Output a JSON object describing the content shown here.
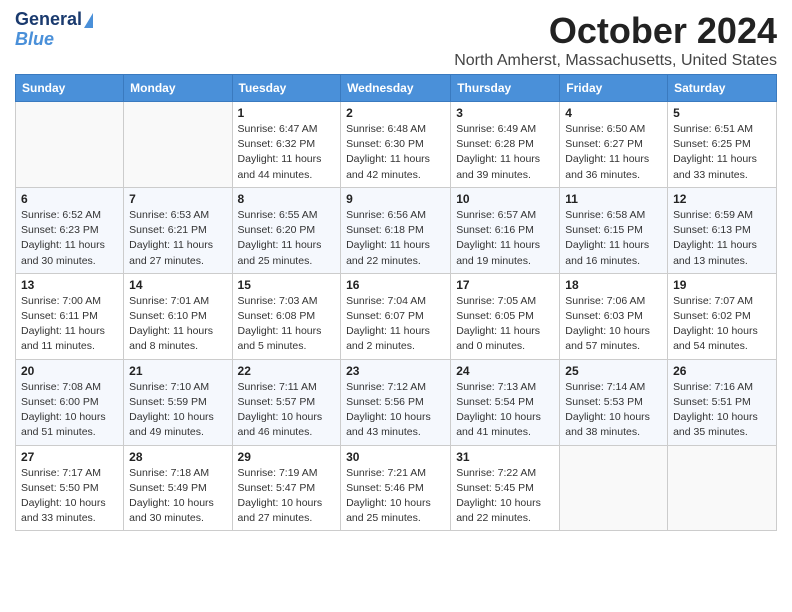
{
  "header": {
    "logo_line1": "General",
    "logo_line2": "Blue",
    "month_title": "October 2024",
    "location": "North Amherst, Massachusetts, United States"
  },
  "weekdays": [
    "Sunday",
    "Monday",
    "Tuesday",
    "Wednesday",
    "Thursday",
    "Friday",
    "Saturday"
  ],
  "weeks": [
    [
      {
        "day": "",
        "detail": ""
      },
      {
        "day": "",
        "detail": ""
      },
      {
        "day": "1",
        "detail": "Sunrise: 6:47 AM\nSunset: 6:32 PM\nDaylight: 11 hours and 44 minutes."
      },
      {
        "day": "2",
        "detail": "Sunrise: 6:48 AM\nSunset: 6:30 PM\nDaylight: 11 hours and 42 minutes."
      },
      {
        "day": "3",
        "detail": "Sunrise: 6:49 AM\nSunset: 6:28 PM\nDaylight: 11 hours and 39 minutes."
      },
      {
        "day": "4",
        "detail": "Sunrise: 6:50 AM\nSunset: 6:27 PM\nDaylight: 11 hours and 36 minutes."
      },
      {
        "day": "5",
        "detail": "Sunrise: 6:51 AM\nSunset: 6:25 PM\nDaylight: 11 hours and 33 minutes."
      }
    ],
    [
      {
        "day": "6",
        "detail": "Sunrise: 6:52 AM\nSunset: 6:23 PM\nDaylight: 11 hours and 30 minutes."
      },
      {
        "day": "7",
        "detail": "Sunrise: 6:53 AM\nSunset: 6:21 PM\nDaylight: 11 hours and 27 minutes."
      },
      {
        "day": "8",
        "detail": "Sunrise: 6:55 AM\nSunset: 6:20 PM\nDaylight: 11 hours and 25 minutes."
      },
      {
        "day": "9",
        "detail": "Sunrise: 6:56 AM\nSunset: 6:18 PM\nDaylight: 11 hours and 22 minutes."
      },
      {
        "day": "10",
        "detail": "Sunrise: 6:57 AM\nSunset: 6:16 PM\nDaylight: 11 hours and 19 minutes."
      },
      {
        "day": "11",
        "detail": "Sunrise: 6:58 AM\nSunset: 6:15 PM\nDaylight: 11 hours and 16 minutes."
      },
      {
        "day": "12",
        "detail": "Sunrise: 6:59 AM\nSunset: 6:13 PM\nDaylight: 11 hours and 13 minutes."
      }
    ],
    [
      {
        "day": "13",
        "detail": "Sunrise: 7:00 AM\nSunset: 6:11 PM\nDaylight: 11 hours and 11 minutes."
      },
      {
        "day": "14",
        "detail": "Sunrise: 7:01 AM\nSunset: 6:10 PM\nDaylight: 11 hours and 8 minutes."
      },
      {
        "day": "15",
        "detail": "Sunrise: 7:03 AM\nSunset: 6:08 PM\nDaylight: 11 hours and 5 minutes."
      },
      {
        "day": "16",
        "detail": "Sunrise: 7:04 AM\nSunset: 6:07 PM\nDaylight: 11 hours and 2 minutes."
      },
      {
        "day": "17",
        "detail": "Sunrise: 7:05 AM\nSunset: 6:05 PM\nDaylight: 11 hours and 0 minutes."
      },
      {
        "day": "18",
        "detail": "Sunrise: 7:06 AM\nSunset: 6:03 PM\nDaylight: 10 hours and 57 minutes."
      },
      {
        "day": "19",
        "detail": "Sunrise: 7:07 AM\nSunset: 6:02 PM\nDaylight: 10 hours and 54 minutes."
      }
    ],
    [
      {
        "day": "20",
        "detail": "Sunrise: 7:08 AM\nSunset: 6:00 PM\nDaylight: 10 hours and 51 minutes."
      },
      {
        "day": "21",
        "detail": "Sunrise: 7:10 AM\nSunset: 5:59 PM\nDaylight: 10 hours and 49 minutes."
      },
      {
        "day": "22",
        "detail": "Sunrise: 7:11 AM\nSunset: 5:57 PM\nDaylight: 10 hours and 46 minutes."
      },
      {
        "day": "23",
        "detail": "Sunrise: 7:12 AM\nSunset: 5:56 PM\nDaylight: 10 hours and 43 minutes."
      },
      {
        "day": "24",
        "detail": "Sunrise: 7:13 AM\nSunset: 5:54 PM\nDaylight: 10 hours and 41 minutes."
      },
      {
        "day": "25",
        "detail": "Sunrise: 7:14 AM\nSunset: 5:53 PM\nDaylight: 10 hours and 38 minutes."
      },
      {
        "day": "26",
        "detail": "Sunrise: 7:16 AM\nSunset: 5:51 PM\nDaylight: 10 hours and 35 minutes."
      }
    ],
    [
      {
        "day": "27",
        "detail": "Sunrise: 7:17 AM\nSunset: 5:50 PM\nDaylight: 10 hours and 33 minutes."
      },
      {
        "day": "28",
        "detail": "Sunrise: 7:18 AM\nSunset: 5:49 PM\nDaylight: 10 hours and 30 minutes."
      },
      {
        "day": "29",
        "detail": "Sunrise: 7:19 AM\nSunset: 5:47 PM\nDaylight: 10 hours and 27 minutes."
      },
      {
        "day": "30",
        "detail": "Sunrise: 7:21 AM\nSunset: 5:46 PM\nDaylight: 10 hours and 25 minutes."
      },
      {
        "day": "31",
        "detail": "Sunrise: 7:22 AM\nSunset: 5:45 PM\nDaylight: 10 hours and 22 minutes."
      },
      {
        "day": "",
        "detail": ""
      },
      {
        "day": "",
        "detail": ""
      }
    ]
  ]
}
